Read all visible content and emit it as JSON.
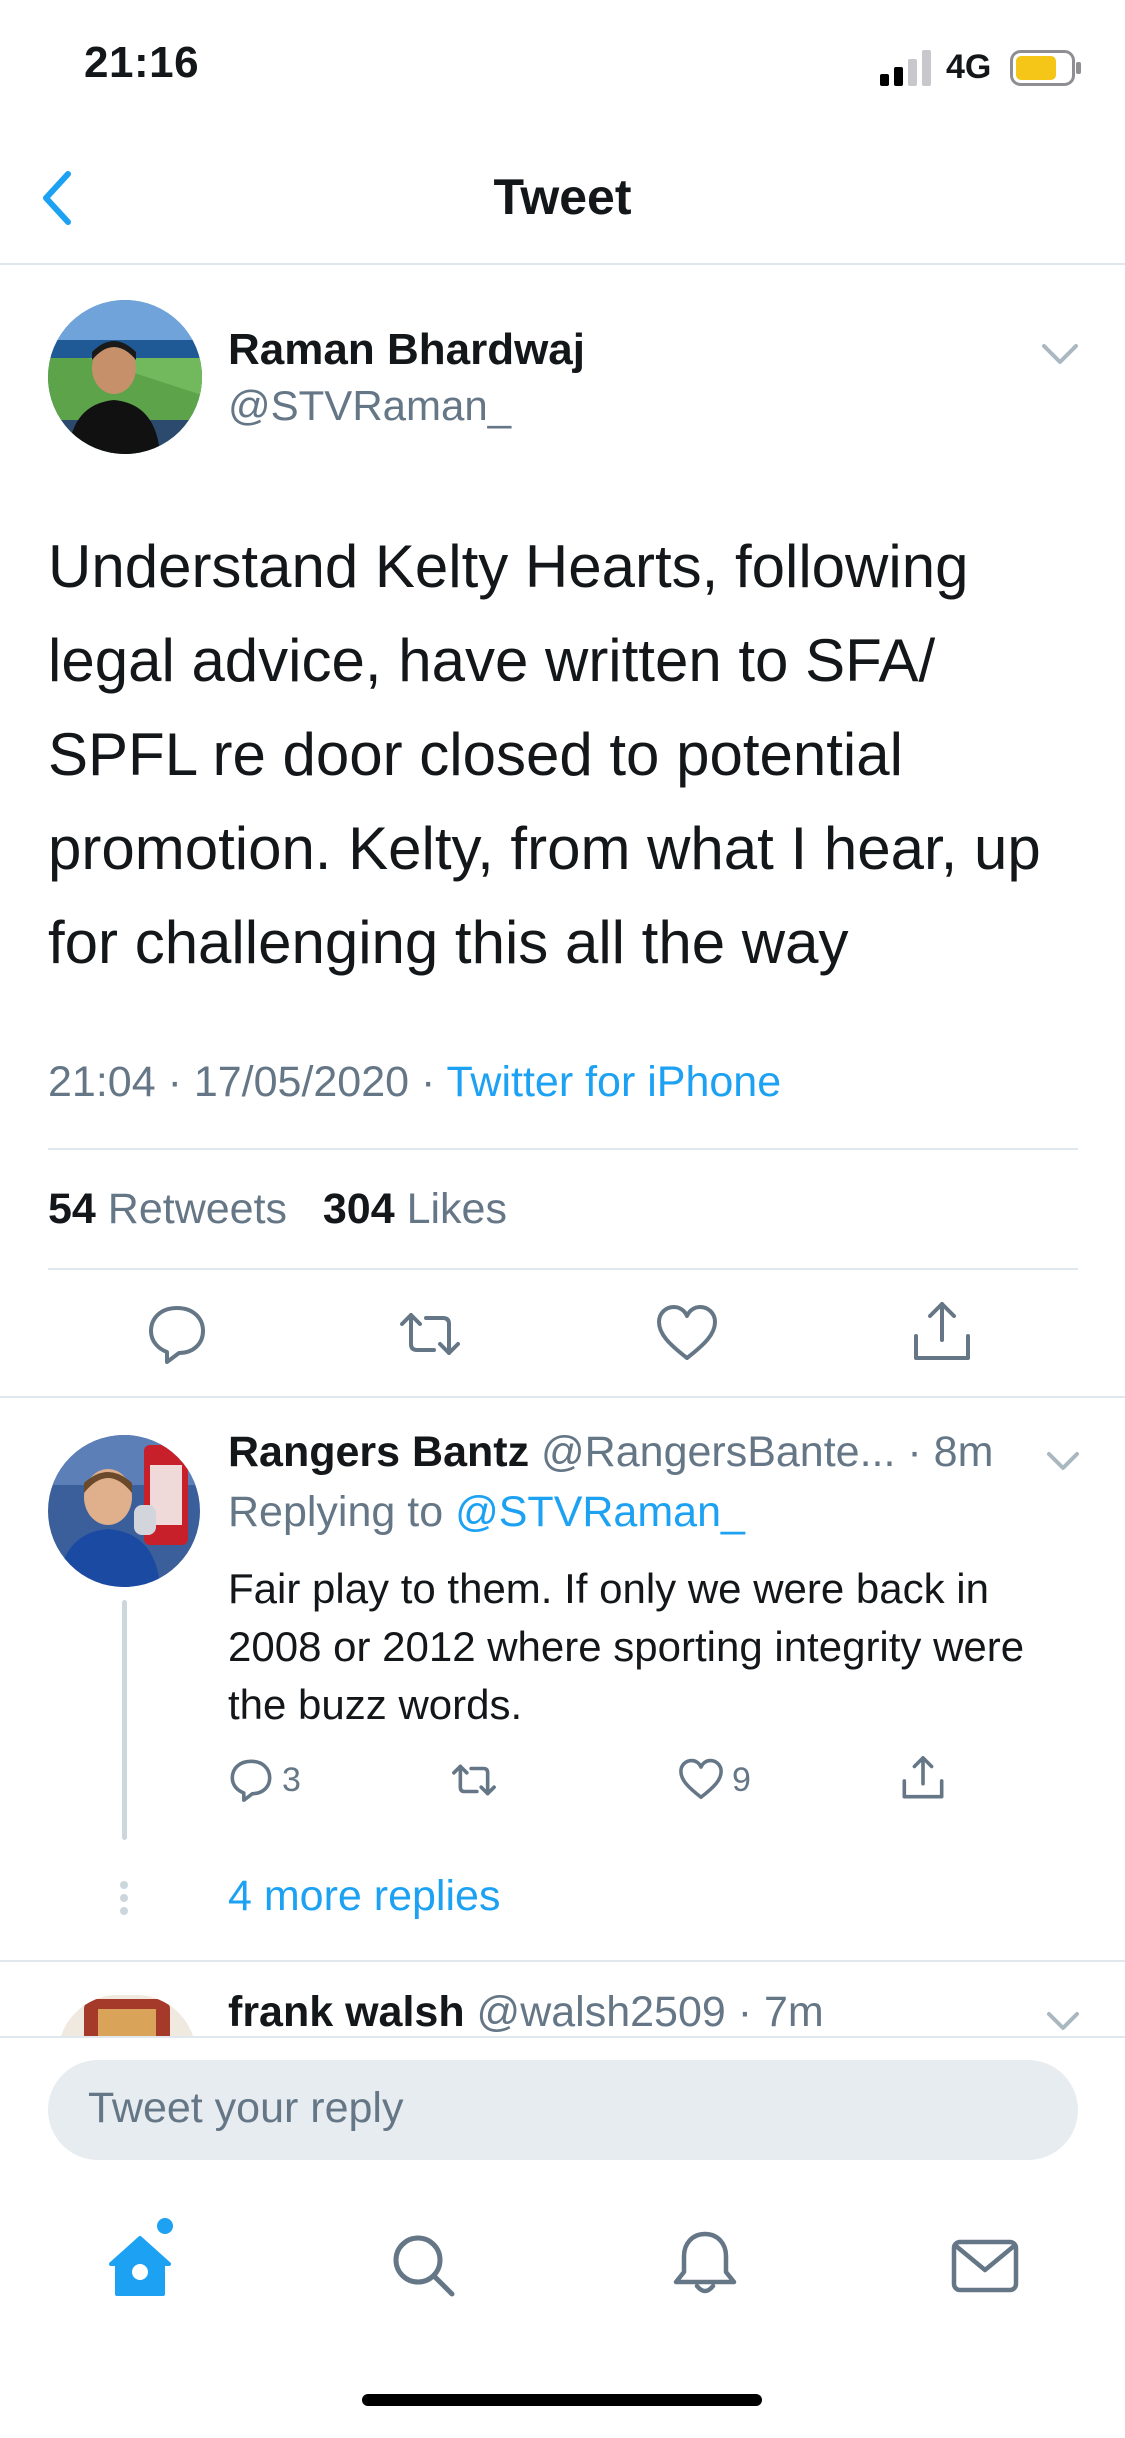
{
  "status_bar": {
    "time": "21:16",
    "network": "4G",
    "battery_color": "#f5c518"
  },
  "nav": {
    "title": "Tweet",
    "back_icon": "chevron-left-icon"
  },
  "main_tweet": {
    "author_name": "Raman Bhardwaj",
    "author_handle": "@STVRaman_",
    "text": "Understand Kelty Hearts, following legal advice, have written to SFA/ SPFL re door closed to potential promotion. Kelty, from what I hear, up for challenging this all the way",
    "time": "21:04",
    "date": "17/05/2020",
    "separator": "·",
    "source": "Twitter for iPhone",
    "retweets_count": "54",
    "retweets_label": "Retweets",
    "likes_count": "304",
    "likes_label": "Likes",
    "actions": [
      "reply-icon",
      "retweet-icon",
      "like-icon",
      "share-icon"
    ]
  },
  "reply_1": {
    "author_name": "Rangers Bantz",
    "author_handle": "@RangersBante...",
    "age": "· 8m",
    "replying_prefix": "Replying to",
    "replying_to": "@STVRaman_",
    "text": "Fair play to them. If only we were back in 2008 or 2012 where sporting integrity were the buzz words.",
    "reply_count": "3",
    "like_count": "9",
    "more_replies": "4 more replies"
  },
  "reply_2": {
    "author_name": "frank walsh",
    "author_handle": "@walsh2509",
    "age": "· 7m"
  },
  "composer": {
    "placeholder": "Tweet your reply"
  },
  "tab_bar": {
    "items": [
      "home-icon",
      "search-icon",
      "notifications-icon",
      "messages-icon"
    ]
  },
  "colors": {
    "accent": "#1da1f2",
    "secondary_text": "#657786",
    "divider": "#e1e8ed"
  }
}
